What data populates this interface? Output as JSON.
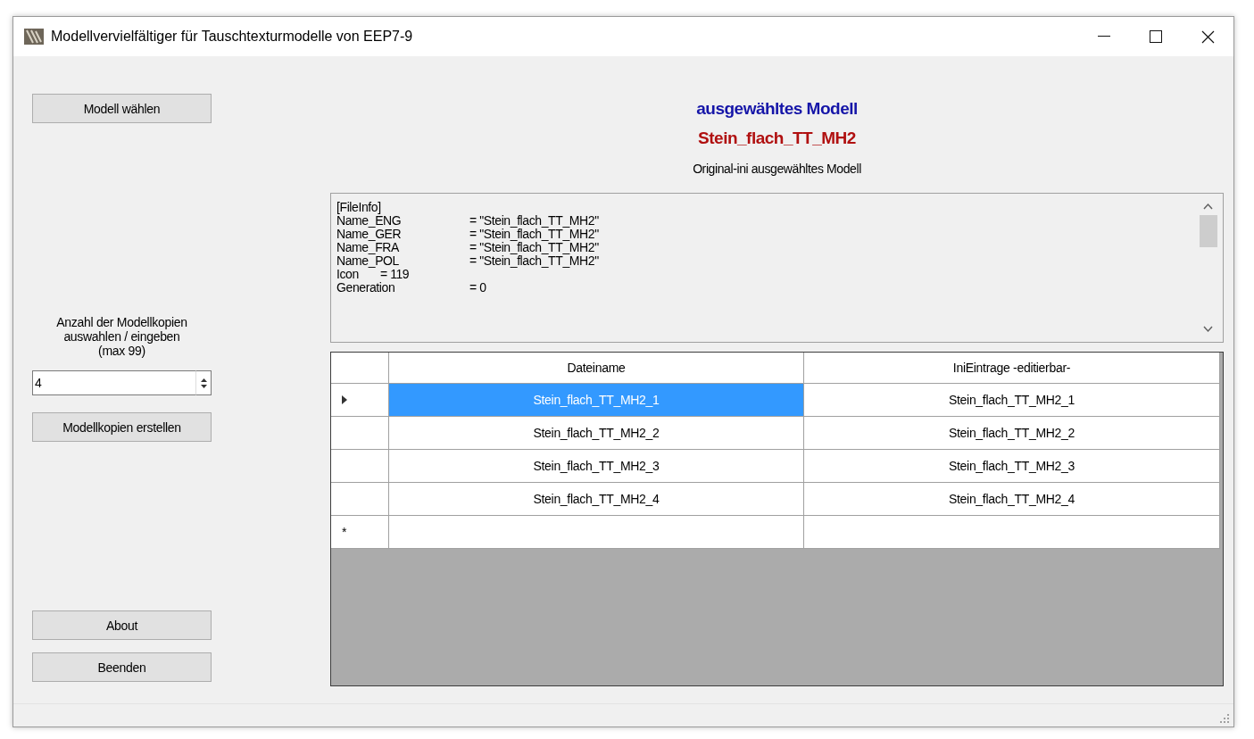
{
  "window": {
    "title": "Modellvervielfältiger für Tauschtexturmodelle von EEP7-9"
  },
  "choose_button": "Modell wählen",
  "copies": {
    "label_lines": [
      "Anzahl der Modellkopien",
      "auswahlen / eingeben",
      "(max 99)"
    ],
    "value": "4",
    "create_button": "Modellkopien erstellen"
  },
  "about_button": "About",
  "quit_button": "Beenden",
  "selected_model": {
    "heading": "ausgewähltes Modell",
    "name": "Stein_flach_TT_MH2",
    "caption": "Original-ini ausgewähltes Modell"
  },
  "ini_lines": [
    {
      "key": "[FileInfo]",
      "kind": "plain"
    },
    {
      "key": "Name_ENG",
      "value": "= \"Stein_flach_TT_MH2\"",
      "kind": "column"
    },
    {
      "key": "Name_GER",
      "value": "= \"Stein_flach_TT_MH2\"",
      "kind": "column"
    },
    {
      "key": "Name_FRA",
      "value": "= \"Stein_flach_TT_MH2\"",
      "kind": "column"
    },
    {
      "key": "Name_POL",
      "value": "= \"Stein_flach_TT_MH2\"",
      "kind": "column"
    },
    {
      "key": "Icon",
      "value": "= 119",
      "kind": "short"
    },
    {
      "key": "Generation",
      "value": "= 0",
      "kind": "column"
    }
  ],
  "grid": {
    "columns": [
      "Dateiname",
      "IniEintrage -editierbar-"
    ],
    "rows": [
      {
        "cells": [
          "Stein_flach_TT_MH2_1",
          "Stein_flach_TT_MH2_1"
        ],
        "selected": true,
        "current": true
      },
      {
        "cells": [
          "Stein_flach_TT_MH2_2",
          "Stein_flach_TT_MH2_2"
        ],
        "selected": false,
        "current": false
      },
      {
        "cells": [
          "Stein_flach_TT_MH2_3",
          "Stein_flach_TT_MH2_3"
        ],
        "selected": false,
        "current": false
      },
      {
        "cells": [
          "Stein_flach_TT_MH2_4",
          "Stein_flach_TT_MH2_4"
        ],
        "selected": false,
        "current": false
      }
    ],
    "new_row_marker": "*"
  }
}
